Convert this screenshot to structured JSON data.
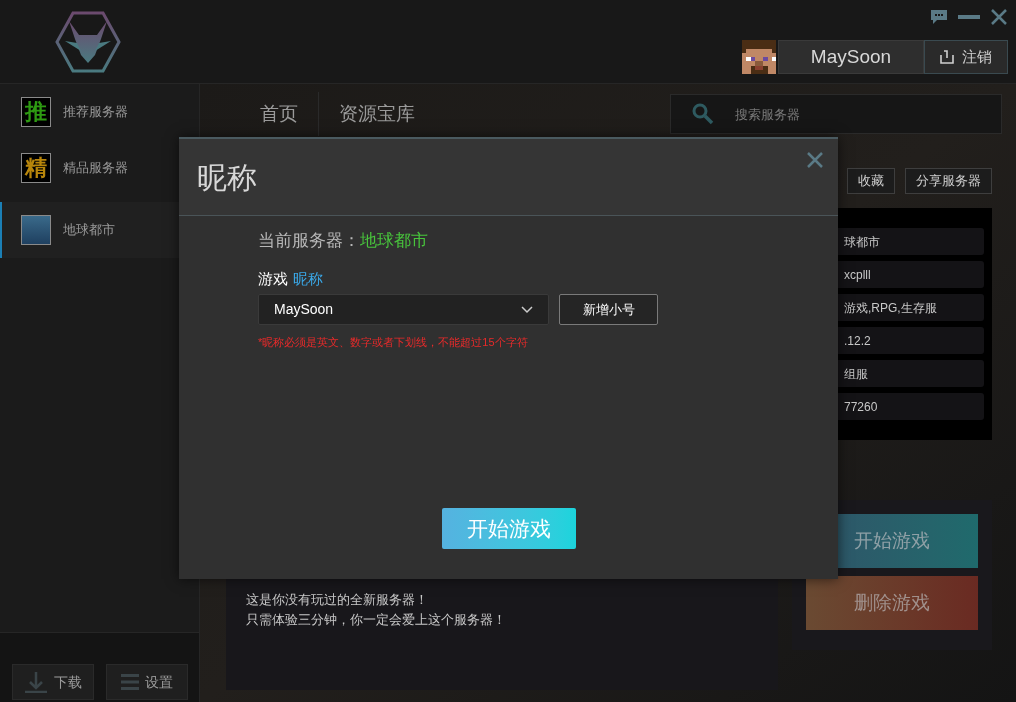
{
  "user": {
    "name": "MaySoon",
    "logout": "注销"
  },
  "sidebar": {
    "items": [
      {
        "kind": "letter",
        "badge": "推",
        "color": "#2e9a12",
        "label": "推荐服务器",
        "selected": false
      },
      {
        "kind": "letter",
        "badge": "精",
        "color": "#b8860b",
        "label": "精品服务器",
        "selected": false
      },
      {
        "kind": "thumbnail",
        "label": "地球都市",
        "selected": true
      }
    ],
    "footer_buttons": [
      {
        "kind": "download",
        "label": "下载"
      },
      {
        "kind": "settings",
        "label": "设置"
      }
    ]
  },
  "nav": {
    "tabs": [
      "首页",
      "资源宝库"
    ]
  },
  "search": {
    "placeholder": "搜索服务器"
  },
  "server_actions": [
    "收藏",
    "分享服务器"
  ],
  "info_rows": [
    "球都市",
    "xcplll",
    "游戏,RPG,生存服",
    ".12.2",
    "组服",
    "77260"
  ],
  "description": [
    "这是你没有玩过的全新服务器！",
    "只需体验三分钟，你一定会爱上这个服务器！"
  ],
  "side_buttons": [
    {
      "kind": "start",
      "label": "开始游戏"
    },
    {
      "kind": "delete",
      "label": "删除游戏"
    }
  ],
  "dialog": {
    "title": "昵称",
    "current_server_label": "当前服务器：",
    "current_server": "地球都市",
    "field_label": "游戏",
    "field_label_accent": "昵称",
    "nickname": "MaySoon",
    "add_button": "新增小号",
    "hint": "*昵称必须是英文、数字或者下划线，不能超过15个字符",
    "start_button": "开始游戏"
  }
}
